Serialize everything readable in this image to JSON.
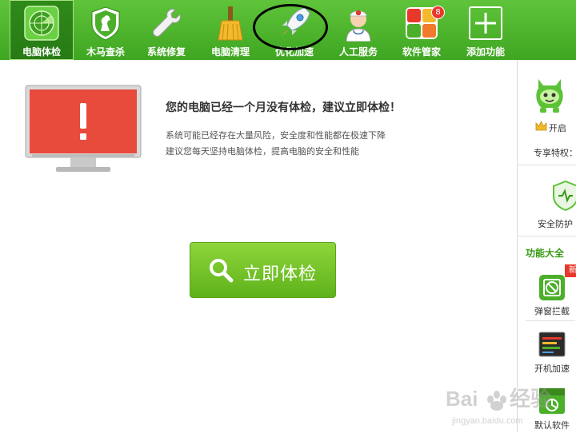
{
  "toolbar": {
    "tabs": [
      {
        "label": "电脑体检",
        "icon": "radar-icon"
      },
      {
        "label": "木马查杀",
        "icon": "horse-shield-icon"
      },
      {
        "label": "系统修复",
        "icon": "wrench-icon"
      },
      {
        "label": "电脑清理",
        "icon": "broom-icon"
      },
      {
        "label": "优化加速",
        "icon": "rocket-icon"
      },
      {
        "label": "人工服务",
        "icon": "doctor-icon"
      },
      {
        "label": "软件管家",
        "icon": "software-grid-icon"
      },
      {
        "label": "添加功能",
        "icon": "plus-icon"
      }
    ],
    "badge_count": "8",
    "active_tab": "电脑体检"
  },
  "main": {
    "headline": "您的电脑已经一个月没有体检，建议立即体检！",
    "desc_line1": "系统可能已经存在大量风险，安全度和性能都在极速下降",
    "desc_line2": "建议您每天坚持电脑体检，提高电脑的安全和性能",
    "scan_button": "立即体检"
  },
  "sidebar": {
    "open_label": "开启",
    "privilege_label": "专享特权：",
    "security_label": "安全防护",
    "section_title": "功能大全",
    "new_tag": "新",
    "items": [
      {
        "label": "弹窗拦截",
        "icon": "popup-block-icon"
      },
      {
        "label": "开机加速",
        "icon": "boot-speed-icon"
      },
      {
        "label": "默认软件",
        "icon": "default-software-icon"
      }
    ]
  },
  "watermark": {
    "brand": "Baidu经验",
    "url": "jingyan.baidu.com"
  },
  "colors": {
    "toolbar_green": "#4cb52c",
    "button_green": "#7cc52f",
    "alert_red": "#e84a3c",
    "section_green": "#3a9a16"
  }
}
